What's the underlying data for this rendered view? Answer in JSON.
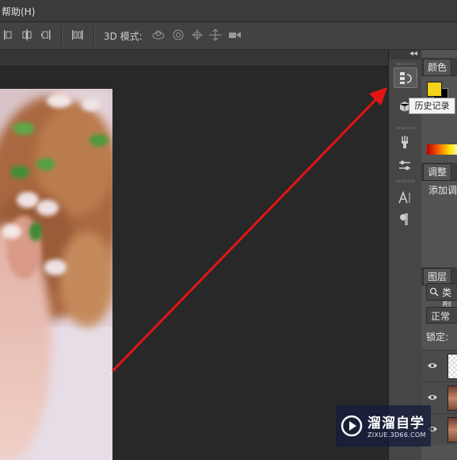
{
  "menubar": {
    "help_label": "帮助(H)"
  },
  "options_bar": {
    "mode3d_label": "3D 模式:"
  },
  "dock": {
    "collapse_glyph": "◂◂",
    "tooltip": "历史记录"
  },
  "panels": {
    "color": {
      "tab": "颜色",
      "foreground": "#f2d21a",
      "background": "#000000"
    },
    "adjustments": {
      "tab": "调整",
      "add_label": "添加调"
    },
    "layers": {
      "tab": "图层",
      "search_placeholder": "类型",
      "blend_mode": "正常",
      "lock_label": "锁定:",
      "rows": [
        {
          "thumb": "transparent",
          "visible": true
        },
        {
          "thumb": "photo",
          "visible": true
        },
        {
          "thumb": "photo",
          "visible": true
        }
      ]
    }
  },
  "watermark": {
    "title": "溜溜自学",
    "subtitle": "ZIXUE.3D66.COM"
  },
  "annotation": {
    "color": "#e41414"
  }
}
